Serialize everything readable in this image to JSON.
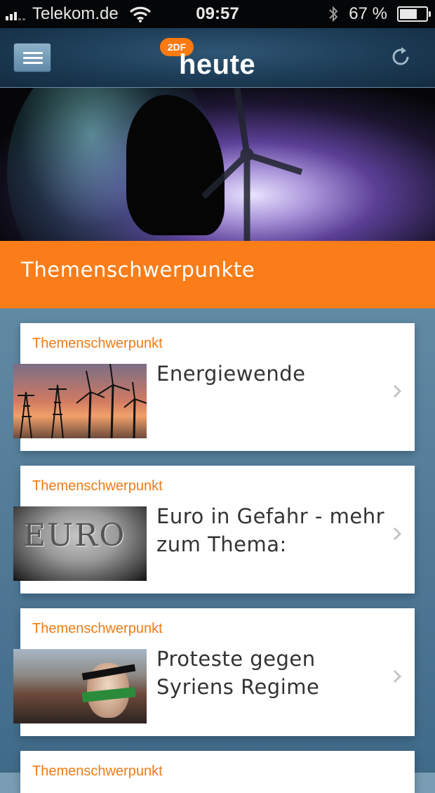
{
  "status_bar": {
    "carrier": "Telekom.de",
    "time": "09:57",
    "battery_percent": "67 %",
    "battery_level": 0.67,
    "signal_bars": 3
  },
  "nav": {
    "logo_brand": "2DF",
    "logo_title": "heute",
    "menu_icon": "hamburger-menu-icon",
    "refresh_icon": "refresh-icon"
  },
  "section": {
    "title": "Themenschwerpunkte"
  },
  "cards": [
    {
      "category": "Themenschwerpunkt",
      "title": "Energiewende",
      "thumb": "wind-turbines-sunset-image"
    },
    {
      "category": "Themenschwerpunkt",
      "title": "Euro in Gefahr - mehr zum Thema:",
      "thumb": "euro-coin-image",
      "thumb_text": "EURO"
    },
    {
      "category": "Themenschwerpunkt",
      "title": "Proteste gegen Syriens Regime",
      "thumb": "syria-protest-image"
    },
    {
      "category": "Themenschwerpunkt"
    }
  ],
  "colors": {
    "accent_orange": "#fa7d19",
    "nav_blue": "#1c3b55",
    "category_orange": "#f07a14"
  }
}
